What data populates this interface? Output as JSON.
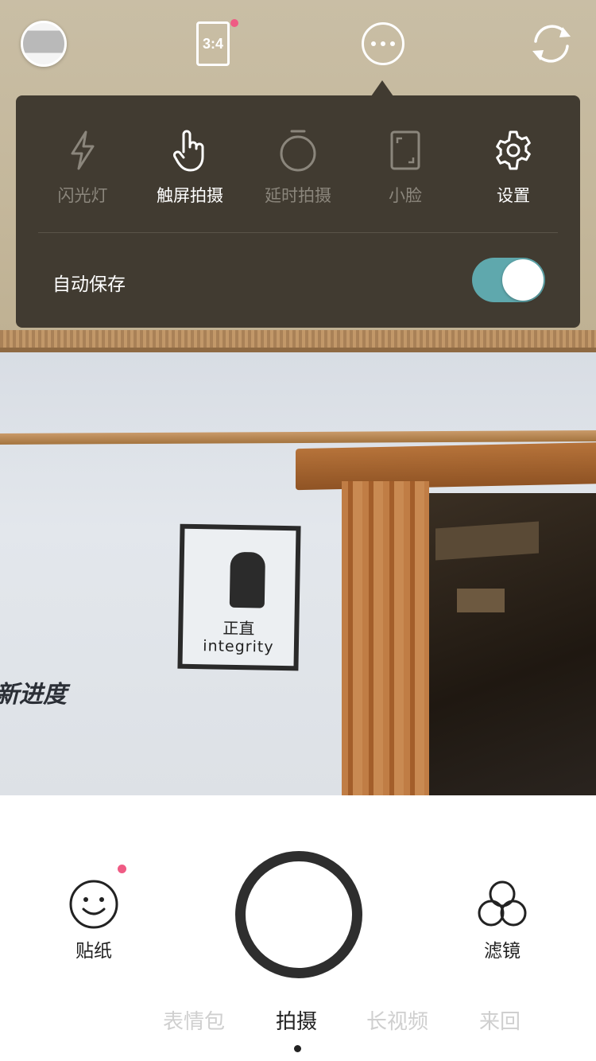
{
  "viewfinder": {
    "poster_text_cn": "正直",
    "poster_text_en": "integrity",
    "wall_text": "新进度"
  },
  "topbar": {
    "aspect_ratio_label": "3:4",
    "icons": [
      "gallery-thumbnail",
      "aspect-ratio-icon",
      "more-icon",
      "switch-camera-icon"
    ]
  },
  "panel": {
    "tools": [
      {
        "label": "闪光灯",
        "icon": "flash-icon",
        "active": false
      },
      {
        "label": "触屏拍摄",
        "icon": "touch-shoot-icon",
        "active": true
      },
      {
        "label": "延时拍摄",
        "icon": "timer-icon",
        "active": false
      },
      {
        "label": "小脸",
        "icon": "small-face-icon",
        "active": false
      },
      {
        "label": "设置",
        "icon": "gear-icon",
        "active": true
      }
    ],
    "autosave": {
      "label": "自动保存",
      "enabled": true
    }
  },
  "bottom": {
    "sticker_label": "贴纸",
    "filter_label": "滤镜",
    "modes": [
      "表情包",
      "拍摄",
      "长视频",
      "来回"
    ],
    "active_mode": "拍摄"
  },
  "colors": {
    "panel_bg": "#413b31",
    "toggle_on": "#5fa8ad",
    "badge": "#ef5b84"
  }
}
